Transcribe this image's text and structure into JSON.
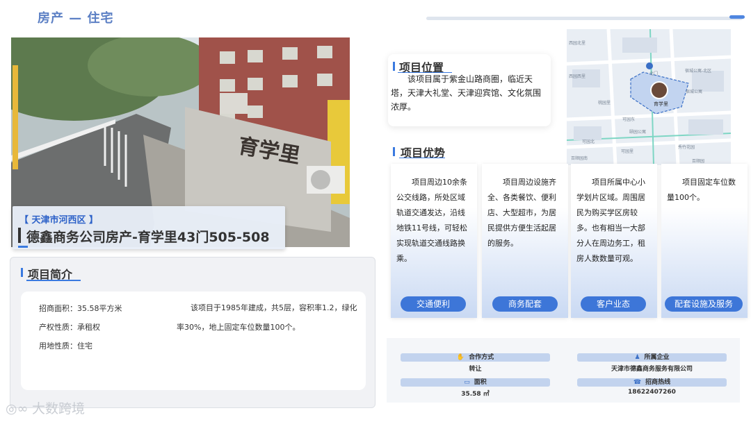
{
  "page": {
    "title": "房产 — 住宅"
  },
  "photo": {
    "sign_text": "育学里",
    "district": "【  天津市河西区  】",
    "project_name": "德鑫商务公司房产-育学里43门505-508"
  },
  "intro": {
    "title": "项目简介",
    "fields": [
      {
        "label": "招商面积：",
        "value": "35.58平方米"
      },
      {
        "label": "产权性质：",
        "value": "承租权"
      },
      {
        "label": "用地性质：",
        "value": "住宅"
      }
    ],
    "description": "该项目于1985年建成，共5层，容积率1.2，绿化率30%，地上固定车位数量100个。"
  },
  "location": {
    "title": "项目位置",
    "text": "该项目属于紫金山路商圈，临近天塔，天津大礼堂、天津迎宾馆、文化氛围浓厚。"
  },
  "map": {
    "labels": [
      "西园北里",
      "宿城公寓-北区",
      "西园西里",
      "北门",
      "宿城公寓",
      "育学里",
      "桃园里",
      "可园东",
      "颐园公寓",
      "可园北",
      "秀竹花园",
      "可园里",
      "百顺园南",
      "百顺园",
      "宿城公寓-北区"
    ]
  },
  "advantages": {
    "title": "项目优势",
    "items": [
      {
        "text": "项目周边10余条公交线路，所处区域轨道交通发达，沿线地铁11号线，可轻松实现轨道交通线路换乘。",
        "label": "交通便利"
      },
      {
        "text": "项目周边设施齐全、各类餐饮、便利店、大型超市，为居民提供方便生活起居的服务。",
        "label": "商务配套"
      },
      {
        "text": "项目所属中心小学划片区域。周围居民为购买学区房较多。也有相当一大部分人在周边务工，租房人数数量可观。",
        "label": "客户业态"
      },
      {
        "text": "项目固定车位数量100个。",
        "label": "配套设施及服务"
      }
    ]
  },
  "info": {
    "cooperation": {
      "label": "合作方式",
      "value": "转让"
    },
    "company": {
      "label": "所属企业",
      "value": "天津市德鑫商务服务有限公司"
    },
    "area": {
      "label": "面积",
      "value": "35.58 ㎡"
    },
    "hotline": {
      "label": "招商热线",
      "value": "18622407260"
    }
  },
  "watermark": {
    "text": "大数跨境"
  },
  "colors": {
    "accent": "#3a7ae0",
    "title": "#5b7fc4",
    "pill": "#3d76d8"
  }
}
